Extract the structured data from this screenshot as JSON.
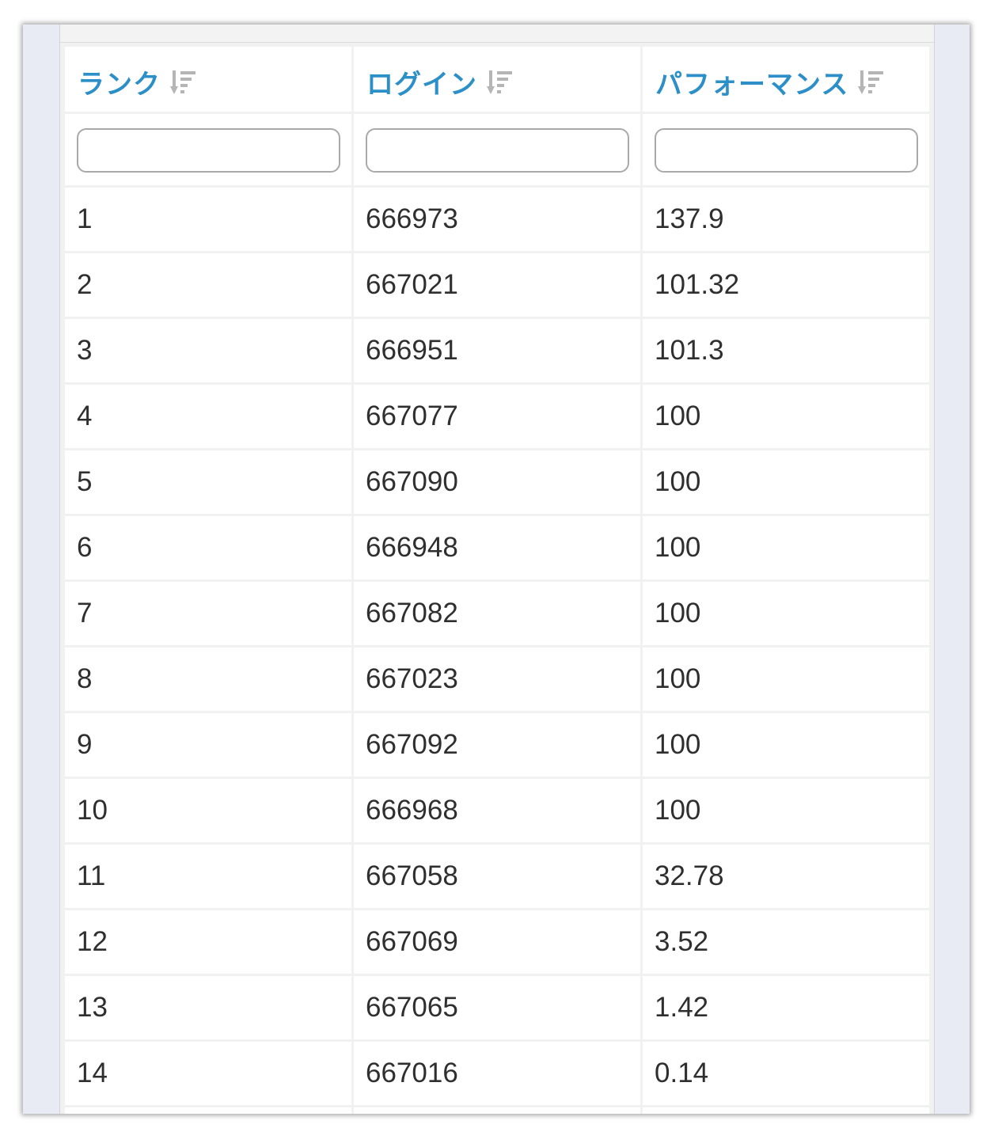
{
  "table": {
    "columns": [
      {
        "label": "ランク",
        "icon": "sort-icon"
      },
      {
        "label": "ログイン",
        "icon": "sort-icon"
      },
      {
        "label": "パフォーマンス",
        "icon": "sort-icon"
      }
    ],
    "filters": [
      {
        "value": "",
        "placeholder": ""
      },
      {
        "value": "",
        "placeholder": ""
      },
      {
        "value": "",
        "placeholder": ""
      }
    ],
    "rows": [
      [
        "1",
        "666973",
        "137.9"
      ],
      [
        "2",
        "667021",
        "101.32"
      ],
      [
        "3",
        "666951",
        "101.3"
      ],
      [
        "4",
        "667077",
        "100"
      ],
      [
        "5",
        "667090",
        "100"
      ],
      [
        "6",
        "666948",
        "100"
      ],
      [
        "7",
        "667082",
        "100"
      ],
      [
        "8",
        "667023",
        "100"
      ],
      [
        "9",
        "667092",
        "100"
      ],
      [
        "10",
        "666968",
        "100"
      ],
      [
        "11",
        "667058",
        "32.78"
      ],
      [
        "12",
        "667069",
        "3.52"
      ],
      [
        "13",
        "667065",
        "1.42"
      ],
      [
        "14",
        "667016",
        "0.14"
      ]
    ]
  },
  "colors": {
    "header_text": "#2c8fc8",
    "cell_text": "#2f2f2f",
    "frame_bg": "#e8ebf3"
  }
}
